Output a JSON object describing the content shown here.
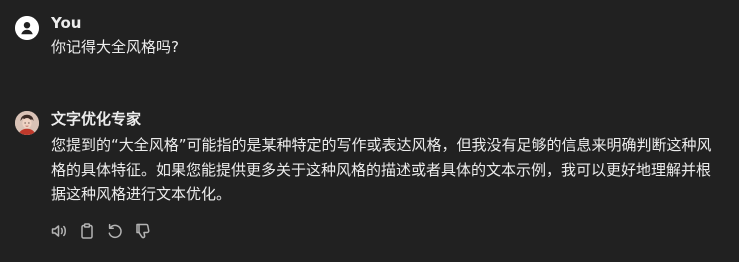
{
  "user_message": {
    "author": "You",
    "text": "你记得大全风格吗?"
  },
  "assistant_message": {
    "author": "文字优化专家",
    "text": "您提到的“大全风格”可能指的是某种特定的写作或表达风格，但我没有足够的信息来明确判断这种风格的具体特征。如果您能提供更多关于这种风格的描述或者具体的文本示例，我可以更好地理解并根据这种风格进行文本优化。"
  },
  "actions": [
    {
      "icon": "speaker-icon"
    },
    {
      "icon": "clipboard-icon"
    },
    {
      "icon": "regenerate-icon"
    },
    {
      "icon": "thumbs-down-icon"
    }
  ],
  "colors": {
    "background": "#212121",
    "text": "#ececec",
    "icon": "#b4b4b4"
  }
}
